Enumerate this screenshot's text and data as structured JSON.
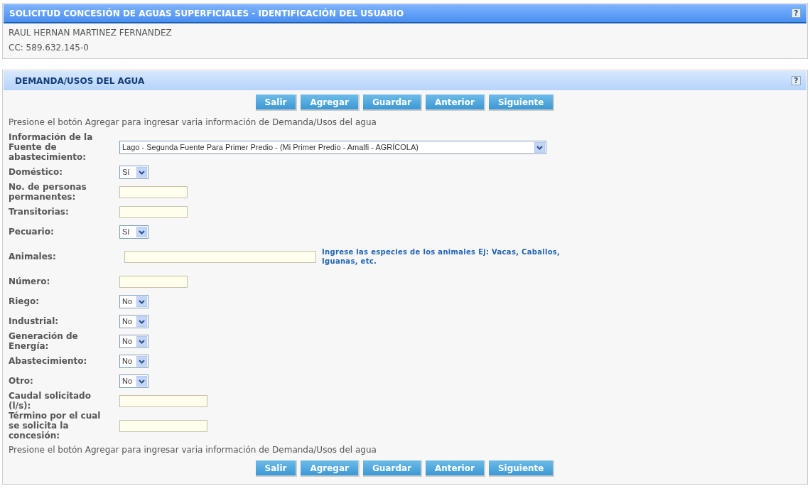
{
  "user_panel": {
    "title": "SOLICITUD CONCESIÓN DE AGUAS SUPERFICIALES - IDENTIFICACIÓN DEL USUARIO",
    "help": "?",
    "lines": [
      "RAUL HERNAN MARTINEZ FERNANDEZ",
      "CC: 589.632.145-0"
    ]
  },
  "demand_panel": {
    "title": "DEMANDA/USOS DEL AGUA",
    "help": "?",
    "buttons": [
      "Salir",
      "Agregar",
      "Guardar",
      "Anterior",
      "Siguiente"
    ],
    "instruction": "Presione el botón Agregar para ingresar varia información de Demanda/Usos del agua",
    "fields": [
      {
        "label": "Información de la Fuente de abastecimiento:",
        "kind": "source-select",
        "value": "Lago - Segunda Fuente Para Primer Predio - (Mi Primer Predio - Amalfi - AGRÍCOLA)"
      },
      {
        "label": "Doméstico:",
        "kind": "select",
        "value": "Sí"
      },
      {
        "label": "No. de personas permanentes:",
        "kind": "text"
      },
      {
        "label": "Transitorias:",
        "kind": "text"
      },
      {
        "label": "Pecuario:",
        "kind": "select",
        "value": "Sí"
      },
      {
        "label": "Animales:",
        "kind": "long-text",
        "hint": "Ingrese las especies de los animales Ej: Vacas, Caballos, Iguanas, etc."
      },
      {
        "label": "Número:",
        "kind": "text"
      },
      {
        "label": "Riego:",
        "kind": "select",
        "value": "No"
      },
      {
        "label": "Industrial:",
        "kind": "select",
        "value": "No"
      },
      {
        "label": "Generación de Energía:",
        "kind": "select",
        "value": "No"
      },
      {
        "label": "Abastecimiento:",
        "kind": "select",
        "value": "No"
      },
      {
        "label": "Otro:",
        "kind": "select",
        "value": "No"
      },
      {
        "label": "Caudal solicitado (l/s):",
        "kind": "medium-text"
      },
      {
        "label": "Término por el cual se solicita la concesión:",
        "kind": "medium-text"
      }
    ],
    "instruction_bottom": "Presione el botón Agregar para ingresar varia información de Demanda/Usos del agua",
    "buttons_bottom": [
      "Salir",
      "Agregar",
      "Guardar",
      "Anterior",
      "Siguiente"
    ]
  }
}
